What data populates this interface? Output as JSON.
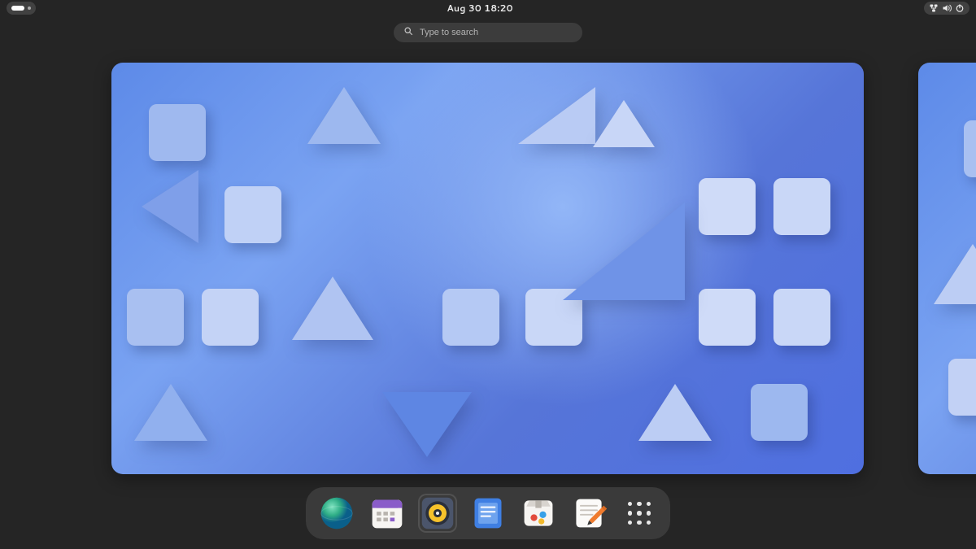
{
  "topbar": {
    "clock": "Aug 30  18:20",
    "tray": {
      "network_icon": "network-wired-icon",
      "volume_icon": "volume-icon",
      "power_icon": "power-icon"
    },
    "activities": {
      "workspace_count": 2,
      "active_workspace": 1
    }
  },
  "search": {
    "placeholder": "Type to search",
    "value": ""
  },
  "workspaces": [
    {
      "name": "workspace-1",
      "active": true
    },
    {
      "name": "workspace-2",
      "active": false
    }
  ],
  "dock": {
    "apps": [
      {
        "id": "web",
        "icon": "web-browser-icon",
        "running": false
      },
      {
        "id": "calendar",
        "icon": "calendar-icon",
        "running": false
      },
      {
        "id": "music",
        "icon": "music-icon",
        "running": false
      },
      {
        "id": "tasks",
        "icon": "todo-icon",
        "running": false
      },
      {
        "id": "software",
        "icon": "software-icon",
        "running": false
      },
      {
        "id": "editor",
        "icon": "text-editor-icon",
        "running": false
      }
    ],
    "show_apps": {
      "icon": "apps-grid-icon"
    }
  }
}
